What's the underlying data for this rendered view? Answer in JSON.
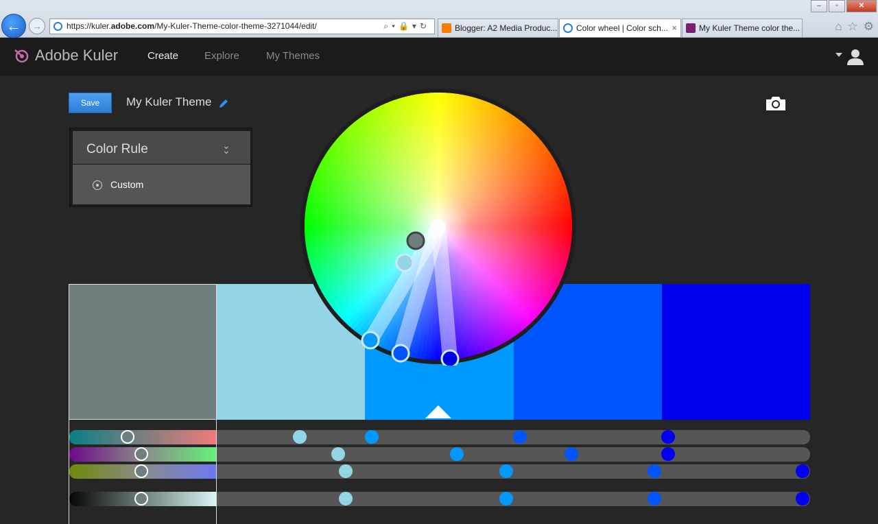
{
  "browser": {
    "url_prefix": "https://kuler.",
    "url_domain": "adobe.com",
    "url_path": "/My-Kuler-Theme-color-theme-3271044/edit/",
    "tabs": [
      {
        "label": "Blogger: A2 Media Produc...",
        "icon_color": "#f57d00"
      },
      {
        "label": "Color wheel | Color sch...",
        "icon_color": "#2a7fd8",
        "close": "×"
      },
      {
        "label": "My Kuler Theme color the...",
        "icon_color": "#7b1f6e"
      }
    ],
    "window_controls": {
      "minimize": "–",
      "maximize": "▫",
      "close": "✕"
    }
  },
  "header": {
    "logo_text": "Adobe Kuler",
    "nav": {
      "create": "Create",
      "explore": "Explore",
      "my_themes": "My Themes"
    }
  },
  "toolbar": {
    "save_label": "Save",
    "theme_name": "My Kuler Theme"
  },
  "color_rule": {
    "title": "Color Rule",
    "selected_option": "Custom"
  },
  "swatch_colors": [
    "#6e7f7d",
    "#93d5e6",
    "#0099ff",
    "#0055ff",
    "#0000ee"
  ],
  "selected_swatch_index": 0,
  "base_swatch_index": 2,
  "accent_color": "#2a7fd6"
}
